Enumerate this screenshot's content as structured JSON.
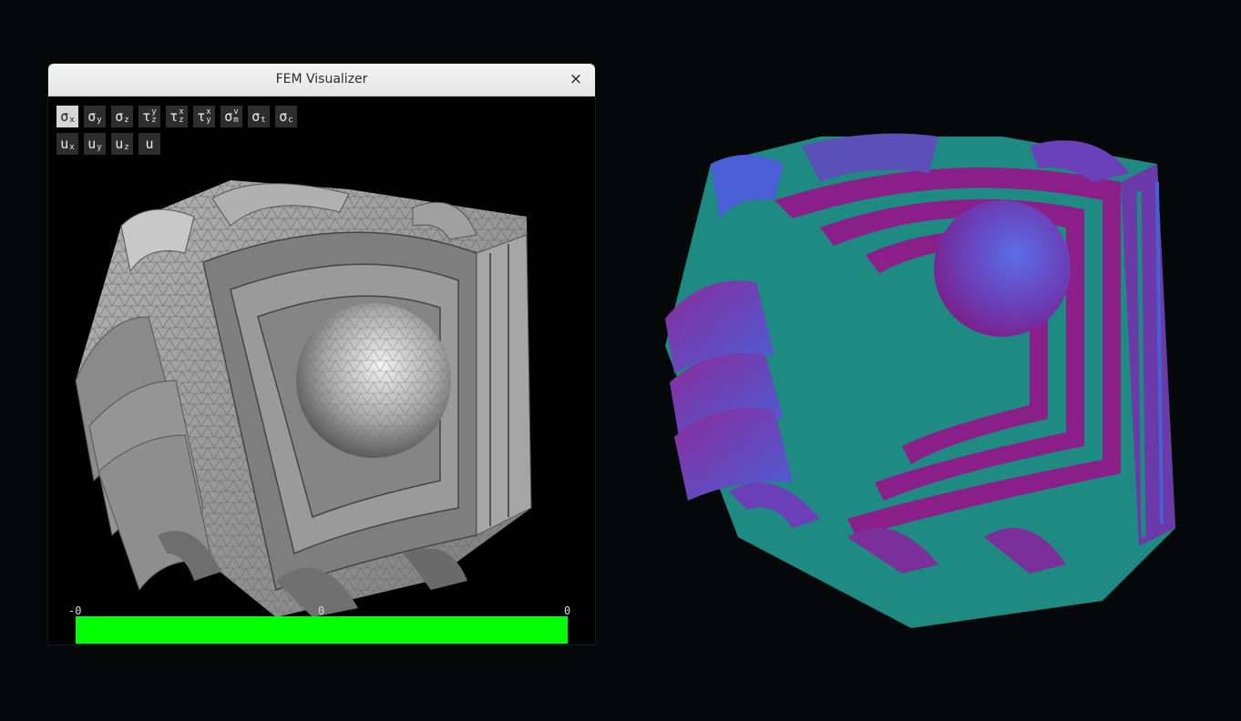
{
  "window": {
    "title": "FEM Visualizer",
    "close_label": "×"
  },
  "toolbar": {
    "stress_buttons": [
      {
        "id": "sigma-x",
        "base": "σ",
        "sub": "x",
        "active": true
      },
      {
        "id": "sigma-y",
        "base": "σ",
        "sub": "y"
      },
      {
        "id": "sigma-z",
        "base": "σ",
        "sub": "z"
      },
      {
        "id": "tau-yz",
        "base": "τ",
        "sup": "y",
        "sub": "z"
      },
      {
        "id": "tau-xz",
        "base": "τ",
        "sup": "x",
        "sub": "z"
      },
      {
        "id": "tau-xy",
        "base": "τ",
        "sup": "x",
        "sub": "y"
      },
      {
        "id": "sigma-vm",
        "base": "σ",
        "sup": "v",
        "sub": "m"
      },
      {
        "id": "sigma-t",
        "base": "σ",
        "sub": "t"
      },
      {
        "id": "sigma-c",
        "base": "σ",
        "sub": "c"
      }
    ],
    "displacement_buttons": [
      {
        "id": "u-x",
        "base": "u",
        "sub": "x"
      },
      {
        "id": "u-y",
        "base": "u",
        "sub": "y"
      },
      {
        "id": "u-z",
        "base": "u",
        "sub": "z"
      },
      {
        "id": "u",
        "base": "u"
      }
    ]
  },
  "colorbar": {
    "min_label": "-0",
    "mid_label": "0",
    "max_label": "0",
    "color": "#00ff00"
  },
  "colors": {
    "mesh_gray": "#9a9a9a",
    "teal": "#1f8a82",
    "magenta": "#8a1f8a",
    "blue": "#4a5fd6"
  }
}
